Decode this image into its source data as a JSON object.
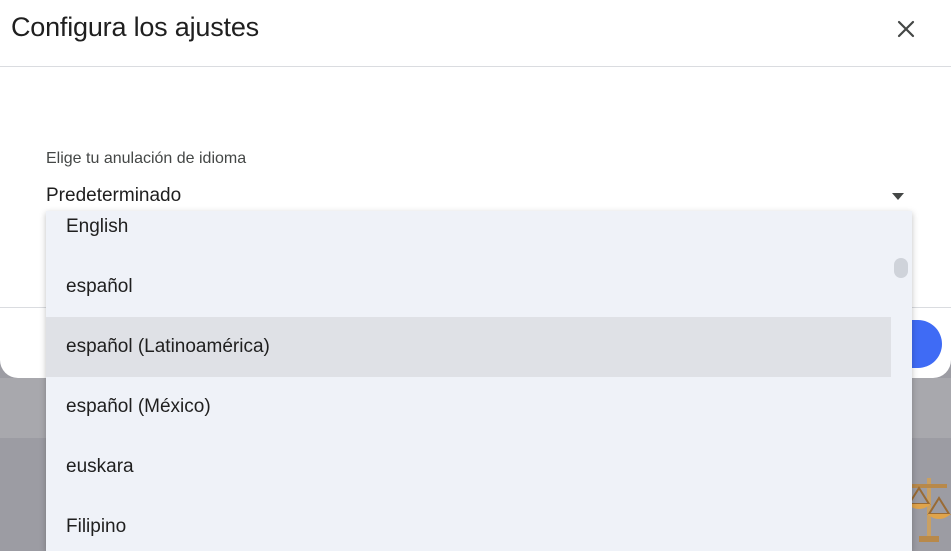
{
  "dialog": {
    "title": "Configura los ajustes",
    "close_icon": "close-icon"
  },
  "language_field": {
    "label": "Elige tu anulación de idioma",
    "value": "Predeterminado",
    "arrow_icon": "dropdown-arrow-icon"
  },
  "dropdown": {
    "options": [
      {
        "label": "English"
      },
      {
        "label": "español"
      },
      {
        "label": "español (Latinoamérica)",
        "highlighted": true
      },
      {
        "label": "español (México)"
      },
      {
        "label": "euskara"
      },
      {
        "label": "Filipino"
      }
    ]
  },
  "colors": {
    "accent": "#3f6bf5",
    "dropdown_bg": "#eff2f8",
    "highlight_bg": "#dfe1e6"
  }
}
